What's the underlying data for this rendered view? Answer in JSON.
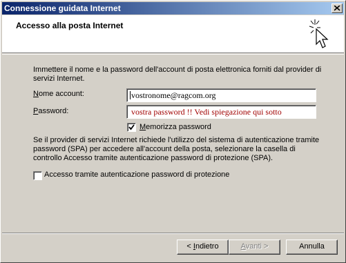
{
  "window": {
    "title": "Connessione guidata Internet",
    "close_glyph": "✕"
  },
  "header": {
    "title": "Accesso alla posta Internet",
    "icon": "wizard-cursor-sparkle-icon"
  },
  "content": {
    "intro_text": "Immettere il nome e la password dell'account di posta elettronica forniti dal provider di servizi Internet.",
    "account_label_mnemonic": "N",
    "account_label_rest": "ome account:",
    "account_value": "vostronome@ragcom.org",
    "password_label_mnemonic": "P",
    "password_label_rest": "assword:",
    "password_value": "vostra password !!  Vedi spiegazione qui sotto",
    "remember_label_mnemonic": "M",
    "remember_label_rest": "emorizza password",
    "remember_checked": true,
    "spa_text": "Se il provider di servizi Internet richiede l'utilizzo del sistema di autenticazione tramite password (SPA) per accedere all'account della posta, selezionare la casella di controllo Accesso tramite autenticazione password di protezione (SPA).",
    "spa_label": "Accesso tramite autenticazione password di protezione",
    "spa_checked": false
  },
  "buttons": {
    "back_prefix": "< ",
    "back_mnemonic": "I",
    "back_rest": "ndietro",
    "next_mnemonic": "A",
    "next_rest": "vanti >",
    "cancel": "Annulla"
  },
  "colors": {
    "title_gradient_start": "#0a246a",
    "title_gradient_end": "#a6caf0",
    "password_text": "#a00000",
    "face": "#d4d0c8"
  }
}
